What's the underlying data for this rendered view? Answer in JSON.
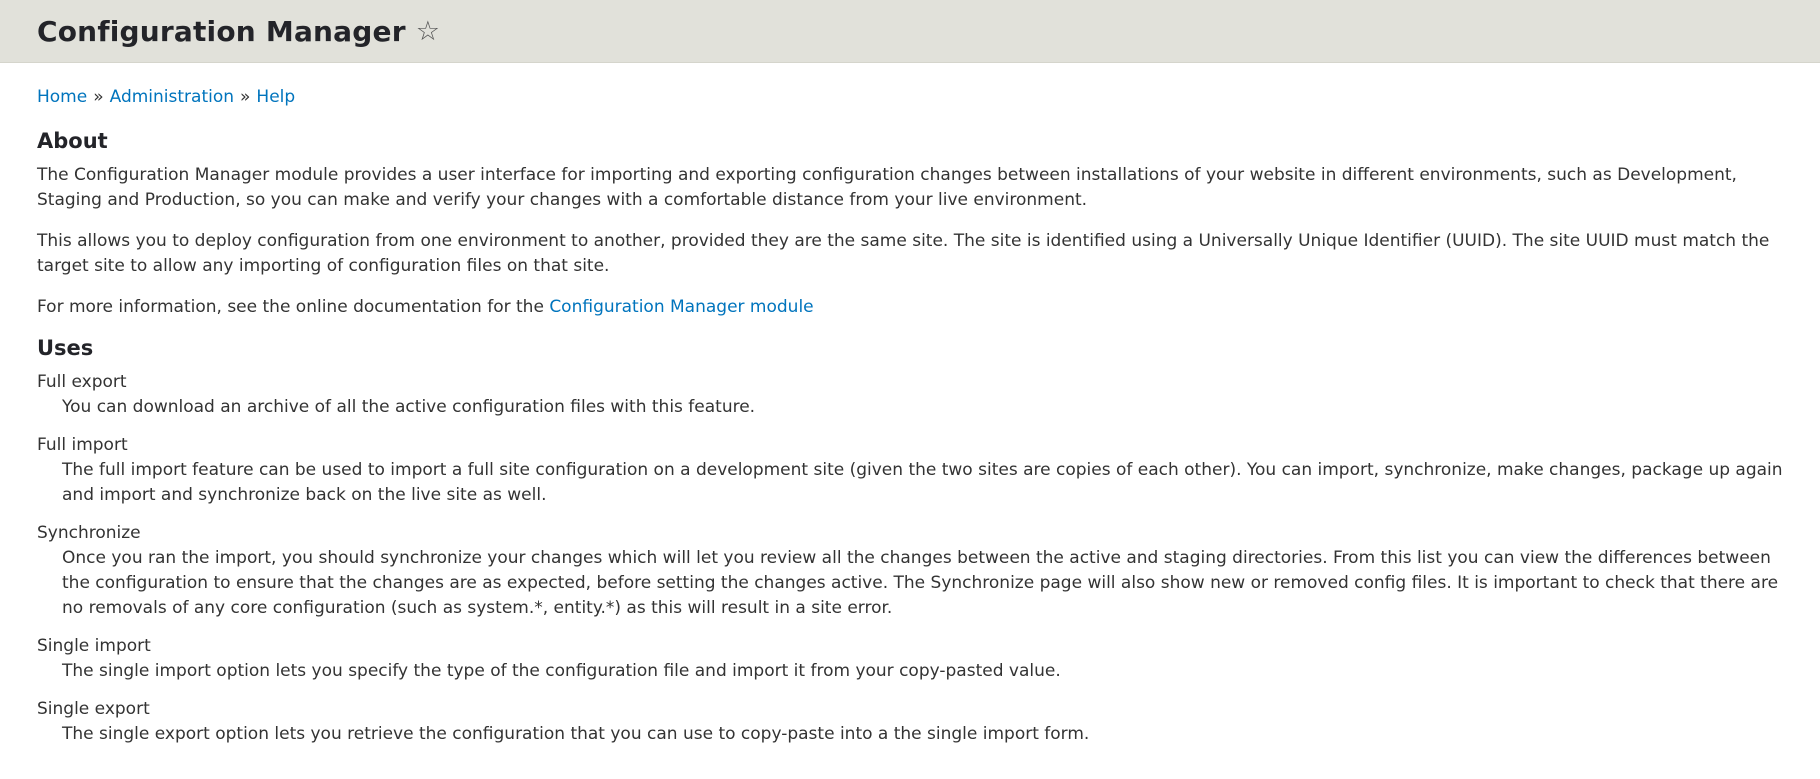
{
  "header": {
    "title": "Configuration Manager",
    "star_icon": "☆"
  },
  "breadcrumb": {
    "items": [
      "Home",
      "Administration",
      "Help"
    ],
    "separator": "»"
  },
  "about": {
    "heading": "About",
    "paragraph1": "The Configuration Manager module provides a user interface for importing and exporting configuration changes between installations of your website in different environments, such as Development, Staging and Production, so you can make and verify your changes with a comfortable distance from your live environment.",
    "paragraph2": "This allows you to deploy configuration from one environment to another, provided they are the same site. The site is identified using a Universally Unique Identifier (UUID). The site UUID must match the target site to allow any importing of configuration files on that site.",
    "more_info_prefix": "For more information, see the online documentation for the ",
    "more_info_link": "Configuration Manager module"
  },
  "uses": {
    "heading": "Uses",
    "items": [
      {
        "term": "Full export",
        "description": "You can download an archive of all the active configuration files with this feature."
      },
      {
        "term": "Full import",
        "description": "The full import feature can be used to import a full site configuration on a development site (given the two sites are copies of each other). You can import, synchronize, make changes, package up again and import and synchronize back on the live site as well."
      },
      {
        "term": "Synchronize",
        "description": "Once you ran the import, you should synchronize your changes which will let you review all the changes between the active and staging directories. From this list you can view the differences between the configuration to ensure that the changes are as expected, before setting the changes active. The Synchronize page will also show new or removed config files. It is important to check that there are no removals of any core configuration (such as system.*, entity.*) as this will result in a site error."
      },
      {
        "term": "Single import",
        "description": "The single import option lets you specify the type of the configuration file and import it from your copy-pasted value."
      },
      {
        "term": "Single export",
        "description": "The single export option lets you retrieve the configuration that you can use to copy-paste into a the single import form."
      }
    ]
  }
}
